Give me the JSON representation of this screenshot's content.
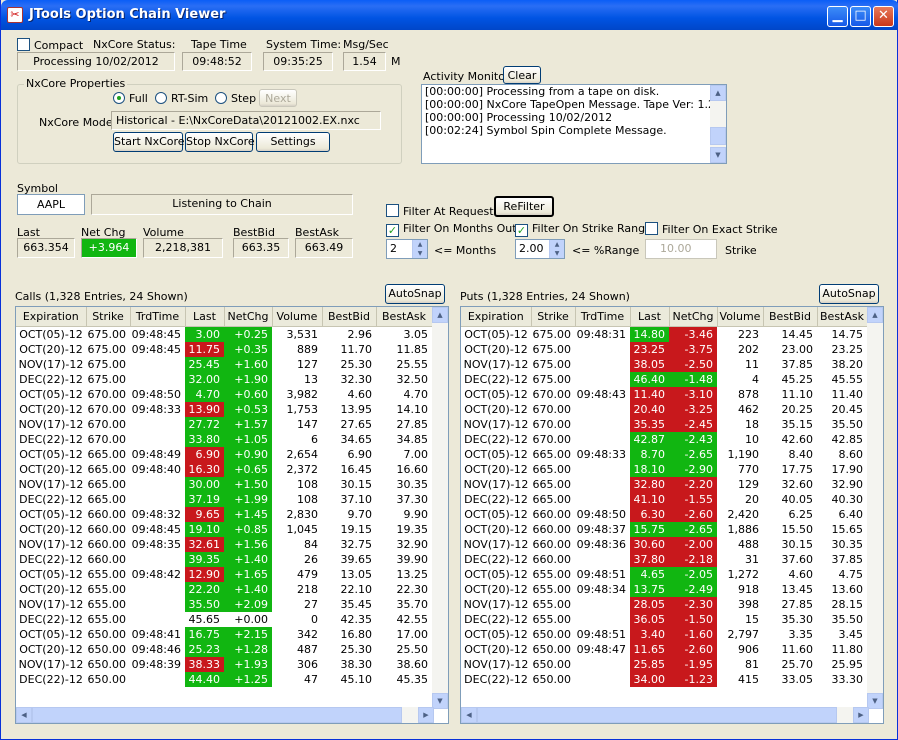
{
  "window": {
    "title": "JTools Option Chain Viewer"
  },
  "status": {
    "compact_label": "Compact",
    "nxcore_status_label": "NxCore Status:",
    "nxcore_status_value": "Processing 10/02/2012",
    "tape_time_label": "Tape Time",
    "tape_time_value": "09:48:52",
    "system_time_label": "System Time:",
    "system_time_value": "09:35:25",
    "msgsec_label": "Msg/Sec",
    "msgsec_value": "1.54",
    "msgsec_unit": "M"
  },
  "nxcore_props": {
    "group_label": "NxCore Properties",
    "radio_full": "Full",
    "radio_rtsim": "RT-Sim",
    "radio_step": "Step",
    "next_label": "Next",
    "mode_label": "NxCore Mode:",
    "mode_value": "Historical - E:\\NxCoreData\\20121002.EX.nxc",
    "start_label": "Start NxCore",
    "stop_label": "Stop NxCore",
    "settings_label": "Settings"
  },
  "activity": {
    "label": "Activity Monitor:",
    "clear_label": "Clear",
    "lines": [
      "[00:00:00] Processing from a tape on disk.",
      "[00:00:00] NxCore TapeOpen Message. Tape Ver: 1.21.1",
      "[00:00:00] Processing 10/02/2012",
      "[00:02:24] Symbol Spin Complete Message."
    ]
  },
  "symbol": {
    "label": "Symbol",
    "value": "AAPL",
    "status": "Listening to Chain",
    "last_label": "Last",
    "last_value": "663.354",
    "netchg_label": "Net Chg",
    "netchg_value": "+3.964",
    "volume_label": "Volume",
    "volume_value": "2,218,381",
    "bestbid_label": "BestBid",
    "bestbid_value": "663.35",
    "bestask_label": "BestAsk",
    "bestask_value": "663.49"
  },
  "filters": {
    "at_request": "Filter At Request",
    "refilter": "ReFilter",
    "months_out": "Filter On Months Out",
    "strike_range": "Filter On Strike Range",
    "exact_strike": "Filter On Exact Strike",
    "months_value": "2",
    "months_suffix": "<= Months",
    "range_value": "2.00",
    "range_suffix": "<= %Range",
    "strike_value": "10.00",
    "strike_suffix": "Strike"
  },
  "colors": {
    "up": "#11b611",
    "down": "#c8181c"
  },
  "calls": {
    "title": "Calls (1,328 Entries, 24 Shown)",
    "autosnap": "AutoSnap",
    "columns": [
      "Expiration",
      "Strike",
      "TrdTime",
      "Last",
      "NetChg",
      "Volume",
      "BestBid",
      "BestAsk"
    ],
    "rows": [
      [
        "OCT(05)-12",
        "675.00",
        "09:48:45",
        "3.00",
        "+0.25",
        "3,531",
        "2.96",
        "3.05",
        "up"
      ],
      [
        "OCT(20)-12",
        "675.00",
        "09:48:45",
        "11.75",
        "+0.35",
        "889",
        "11.70",
        "11.85",
        "dnup"
      ],
      [
        "NOV(17)-12",
        "675.00",
        "",
        "25.45",
        "+1.60",
        "127",
        "25.30",
        "25.55",
        "up"
      ],
      [
        "DEC(22)-12",
        "675.00",
        "",
        "32.00",
        "+1.90",
        "13",
        "32.30",
        "32.50",
        "up"
      ],
      [
        "OCT(05)-12",
        "670.00",
        "09:48:50",
        "4.70",
        "+0.60",
        "3,982",
        "4.60",
        "4.70",
        "up"
      ],
      [
        "OCT(20)-12",
        "670.00",
        "09:48:33",
        "13.90",
        "+0.53",
        "1,753",
        "13.95",
        "14.10",
        "dnup"
      ],
      [
        "NOV(17)-12",
        "670.00",
        "",
        "27.72",
        "+1.57",
        "147",
        "27.65",
        "27.85",
        "up"
      ],
      [
        "DEC(22)-12",
        "670.00",
        "",
        "33.80",
        "+1.05",
        "6",
        "34.65",
        "34.85",
        "up"
      ],
      [
        "OCT(05)-12",
        "665.00",
        "09:48:49",
        "6.90",
        "+0.90",
        "2,654",
        "6.90",
        "7.00",
        "dnup"
      ],
      [
        "OCT(20)-12",
        "665.00",
        "09:48:40",
        "16.30",
        "+0.65",
        "2,372",
        "16.45",
        "16.60",
        "dnup"
      ],
      [
        "NOV(17)-12",
        "665.00",
        "",
        "30.00",
        "+1.50",
        "108",
        "30.15",
        "30.35",
        "up"
      ],
      [
        "DEC(22)-12",
        "665.00",
        "",
        "37.19",
        "+1.99",
        "108",
        "37.10",
        "37.30",
        "up"
      ],
      [
        "OCT(05)-12",
        "660.00",
        "09:48:32",
        "9.65",
        "+1.45",
        "2,830",
        "9.70",
        "9.90",
        "dnup"
      ],
      [
        "OCT(20)-12",
        "660.00",
        "09:48:45",
        "19.10",
        "+0.85",
        "1,045",
        "19.15",
        "19.35",
        "up"
      ],
      [
        "NOV(17)-12",
        "660.00",
        "09:48:35",
        "32.61",
        "+1.56",
        "84",
        "32.75",
        "32.90",
        "dnup"
      ],
      [
        "DEC(22)-12",
        "660.00",
        "",
        "39.35",
        "+1.40",
        "26",
        "39.65",
        "39.90",
        "up"
      ],
      [
        "OCT(05)-12",
        "655.00",
        "09:48:42",
        "12.90",
        "+1.65",
        "479",
        "13.05",
        "13.25",
        "dnup"
      ],
      [
        "OCT(20)-12",
        "655.00",
        "",
        "22.20",
        "+1.40",
        "218",
        "22.10",
        "22.30",
        "up"
      ],
      [
        "NOV(17)-12",
        "655.00",
        "",
        "35.50",
        "+2.09",
        "27",
        "35.45",
        "35.70",
        "up"
      ],
      [
        "DEC(22)-12",
        "655.00",
        "",
        "45.65",
        "+0.00",
        "0",
        "42.35",
        "42.55",
        "none"
      ],
      [
        "OCT(05)-12",
        "650.00",
        "09:48:41",
        "16.75",
        "+2.15",
        "342",
        "16.80",
        "17.00",
        "up"
      ],
      [
        "OCT(20)-12",
        "650.00",
        "09:48:46",
        "25.23",
        "+1.28",
        "487",
        "25.30",
        "25.50",
        "up"
      ],
      [
        "NOV(17)-12",
        "650.00",
        "09:48:39",
        "38.33",
        "+1.93",
        "306",
        "38.30",
        "38.60",
        "dnup"
      ],
      [
        "DEC(22)-12",
        "650.00",
        "",
        "44.40",
        "+1.25",
        "47",
        "45.10",
        "45.35",
        "up"
      ]
    ]
  },
  "puts": {
    "title": "Puts (1,328 Entries, 24 Shown)",
    "autosnap": "AutoSnap",
    "columns": [
      "Expiration",
      "Strike",
      "TrdTime",
      "Last",
      "NetChg",
      "Volume",
      "BestBid",
      "BestAsk"
    ],
    "rows": [
      [
        "OCT(05)-12",
        "675.00",
        "09:48:31",
        "14.80",
        "-3.46",
        "223",
        "14.45",
        "14.75",
        "updn"
      ],
      [
        "OCT(20)-12",
        "675.00",
        "",
        "23.25",
        "-3.75",
        "202",
        "23.00",
        "23.25",
        "dn"
      ],
      [
        "NOV(17)-12",
        "675.00",
        "",
        "38.05",
        "-2.50",
        "11",
        "37.85",
        "38.20",
        "dn"
      ],
      [
        "DEC(22)-12",
        "675.00",
        "",
        "46.40",
        "-1.48",
        "4",
        "45.25",
        "45.55",
        "up"
      ],
      [
        "OCT(05)-12",
        "670.00",
        "09:48:43",
        "11.40",
        "-3.10",
        "878",
        "11.10",
        "11.40",
        "dn"
      ],
      [
        "OCT(20)-12",
        "670.00",
        "",
        "20.40",
        "-3.25",
        "462",
        "20.25",
        "20.45",
        "dn"
      ],
      [
        "NOV(17)-12",
        "670.00",
        "",
        "35.35",
        "-2.45",
        "18",
        "35.15",
        "35.50",
        "dn"
      ],
      [
        "DEC(22)-12",
        "670.00",
        "",
        "42.87",
        "-2.43",
        "10",
        "42.60",
        "42.85",
        "up"
      ],
      [
        "OCT(05)-12",
        "665.00",
        "09:48:33",
        "8.70",
        "-2.65",
        "1,190",
        "8.40",
        "8.60",
        "up"
      ],
      [
        "OCT(20)-12",
        "665.00",
        "",
        "18.10",
        "-2.90",
        "770",
        "17.75",
        "17.90",
        "up"
      ],
      [
        "NOV(17)-12",
        "665.00",
        "",
        "32.80",
        "-2.20",
        "129",
        "32.60",
        "32.90",
        "dn"
      ],
      [
        "DEC(22)-12",
        "665.00",
        "",
        "41.10",
        "-1.55",
        "20",
        "40.05",
        "40.30",
        "dn"
      ],
      [
        "OCT(05)-12",
        "660.00",
        "09:48:50",
        "6.30",
        "-2.60",
        "2,420",
        "6.25",
        "6.40",
        "dn"
      ],
      [
        "OCT(20)-12",
        "660.00",
        "09:48:37",
        "15.75",
        "-2.65",
        "1,886",
        "15.50",
        "15.65",
        "up"
      ],
      [
        "NOV(17)-12",
        "660.00",
        "09:48:36",
        "30.60",
        "-2.00",
        "488",
        "30.15",
        "30.35",
        "dn"
      ],
      [
        "DEC(22)-12",
        "660.00",
        "",
        "37.80",
        "-2.18",
        "31",
        "37.60",
        "37.85",
        "dn"
      ],
      [
        "OCT(05)-12",
        "655.00",
        "09:48:51",
        "4.65",
        "-2.05",
        "1,272",
        "4.60",
        "4.75",
        "up"
      ],
      [
        "OCT(20)-12",
        "655.00",
        "09:48:34",
        "13.75",
        "-2.49",
        "918",
        "13.45",
        "13.60",
        "up"
      ],
      [
        "NOV(17)-12",
        "655.00",
        "",
        "28.05",
        "-2.30",
        "398",
        "27.85",
        "28.15",
        "dn"
      ],
      [
        "DEC(22)-12",
        "655.00",
        "",
        "36.05",
        "-1.50",
        "15",
        "35.30",
        "35.50",
        "dn"
      ],
      [
        "OCT(05)-12",
        "650.00",
        "09:48:51",
        "3.40",
        "-1.60",
        "2,797",
        "3.35",
        "3.45",
        "dn"
      ],
      [
        "OCT(20)-12",
        "650.00",
        "09:48:47",
        "11.65",
        "-2.60",
        "906",
        "11.60",
        "11.80",
        "dn"
      ],
      [
        "NOV(17)-12",
        "650.00",
        "",
        "25.85",
        "-1.95",
        "81",
        "25.70",
        "25.95",
        "dn"
      ],
      [
        "DEC(22)-12",
        "650.00",
        "",
        "34.00",
        "-1.23",
        "415",
        "33.05",
        "33.30",
        "dn"
      ]
    ]
  }
}
